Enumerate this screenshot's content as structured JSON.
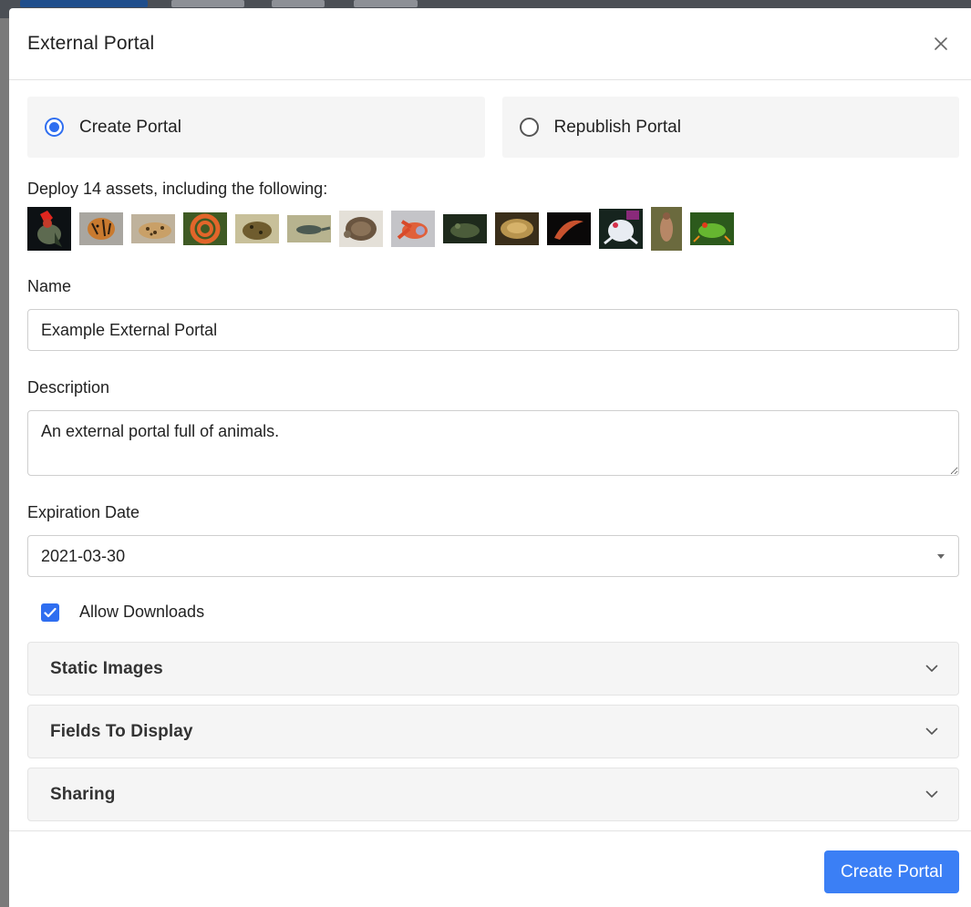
{
  "modal": {
    "title": "External Portal"
  },
  "mode_options": [
    {
      "label": "Create Portal",
      "selected": true
    },
    {
      "label": "Republish Portal",
      "selected": false
    }
  ],
  "deploy_text": "Deploy 14 assets, including the following:",
  "assets": [
    {
      "name": "rooster"
    },
    {
      "name": "tiger-cub"
    },
    {
      "name": "leopard"
    },
    {
      "name": "orange-snake"
    },
    {
      "name": "toad"
    },
    {
      "name": "lizard"
    },
    {
      "name": "turtle"
    },
    {
      "name": "crab"
    },
    {
      "name": "frog-dark"
    },
    {
      "name": "tortoise"
    },
    {
      "name": "shrimp"
    },
    {
      "name": "white-frog"
    },
    {
      "name": "bird"
    },
    {
      "name": "tree-frog"
    }
  ],
  "form": {
    "name_label": "Name",
    "name_value": "Example External Portal",
    "description_label": "Description",
    "description_value": "An external portal full of animals.",
    "expiration_label": "Expiration Date",
    "expiration_value": "2021-03-30",
    "allow_downloads_label": "Allow Downloads",
    "allow_downloads_checked": true
  },
  "sections": [
    {
      "title": "Static Images"
    },
    {
      "title": "Fields To Display"
    },
    {
      "title": "Sharing"
    }
  ],
  "footer": {
    "submit_label": "Create Portal"
  },
  "colors": {
    "accent": "#3b7ff5",
    "radio_checked": "#2f6ef0",
    "card_bg": "#f5f5f5"
  },
  "icons": {
    "close": "close-icon",
    "caret": "caret-down-icon",
    "chevron": "chevron-down-icon",
    "check": "check-icon"
  }
}
